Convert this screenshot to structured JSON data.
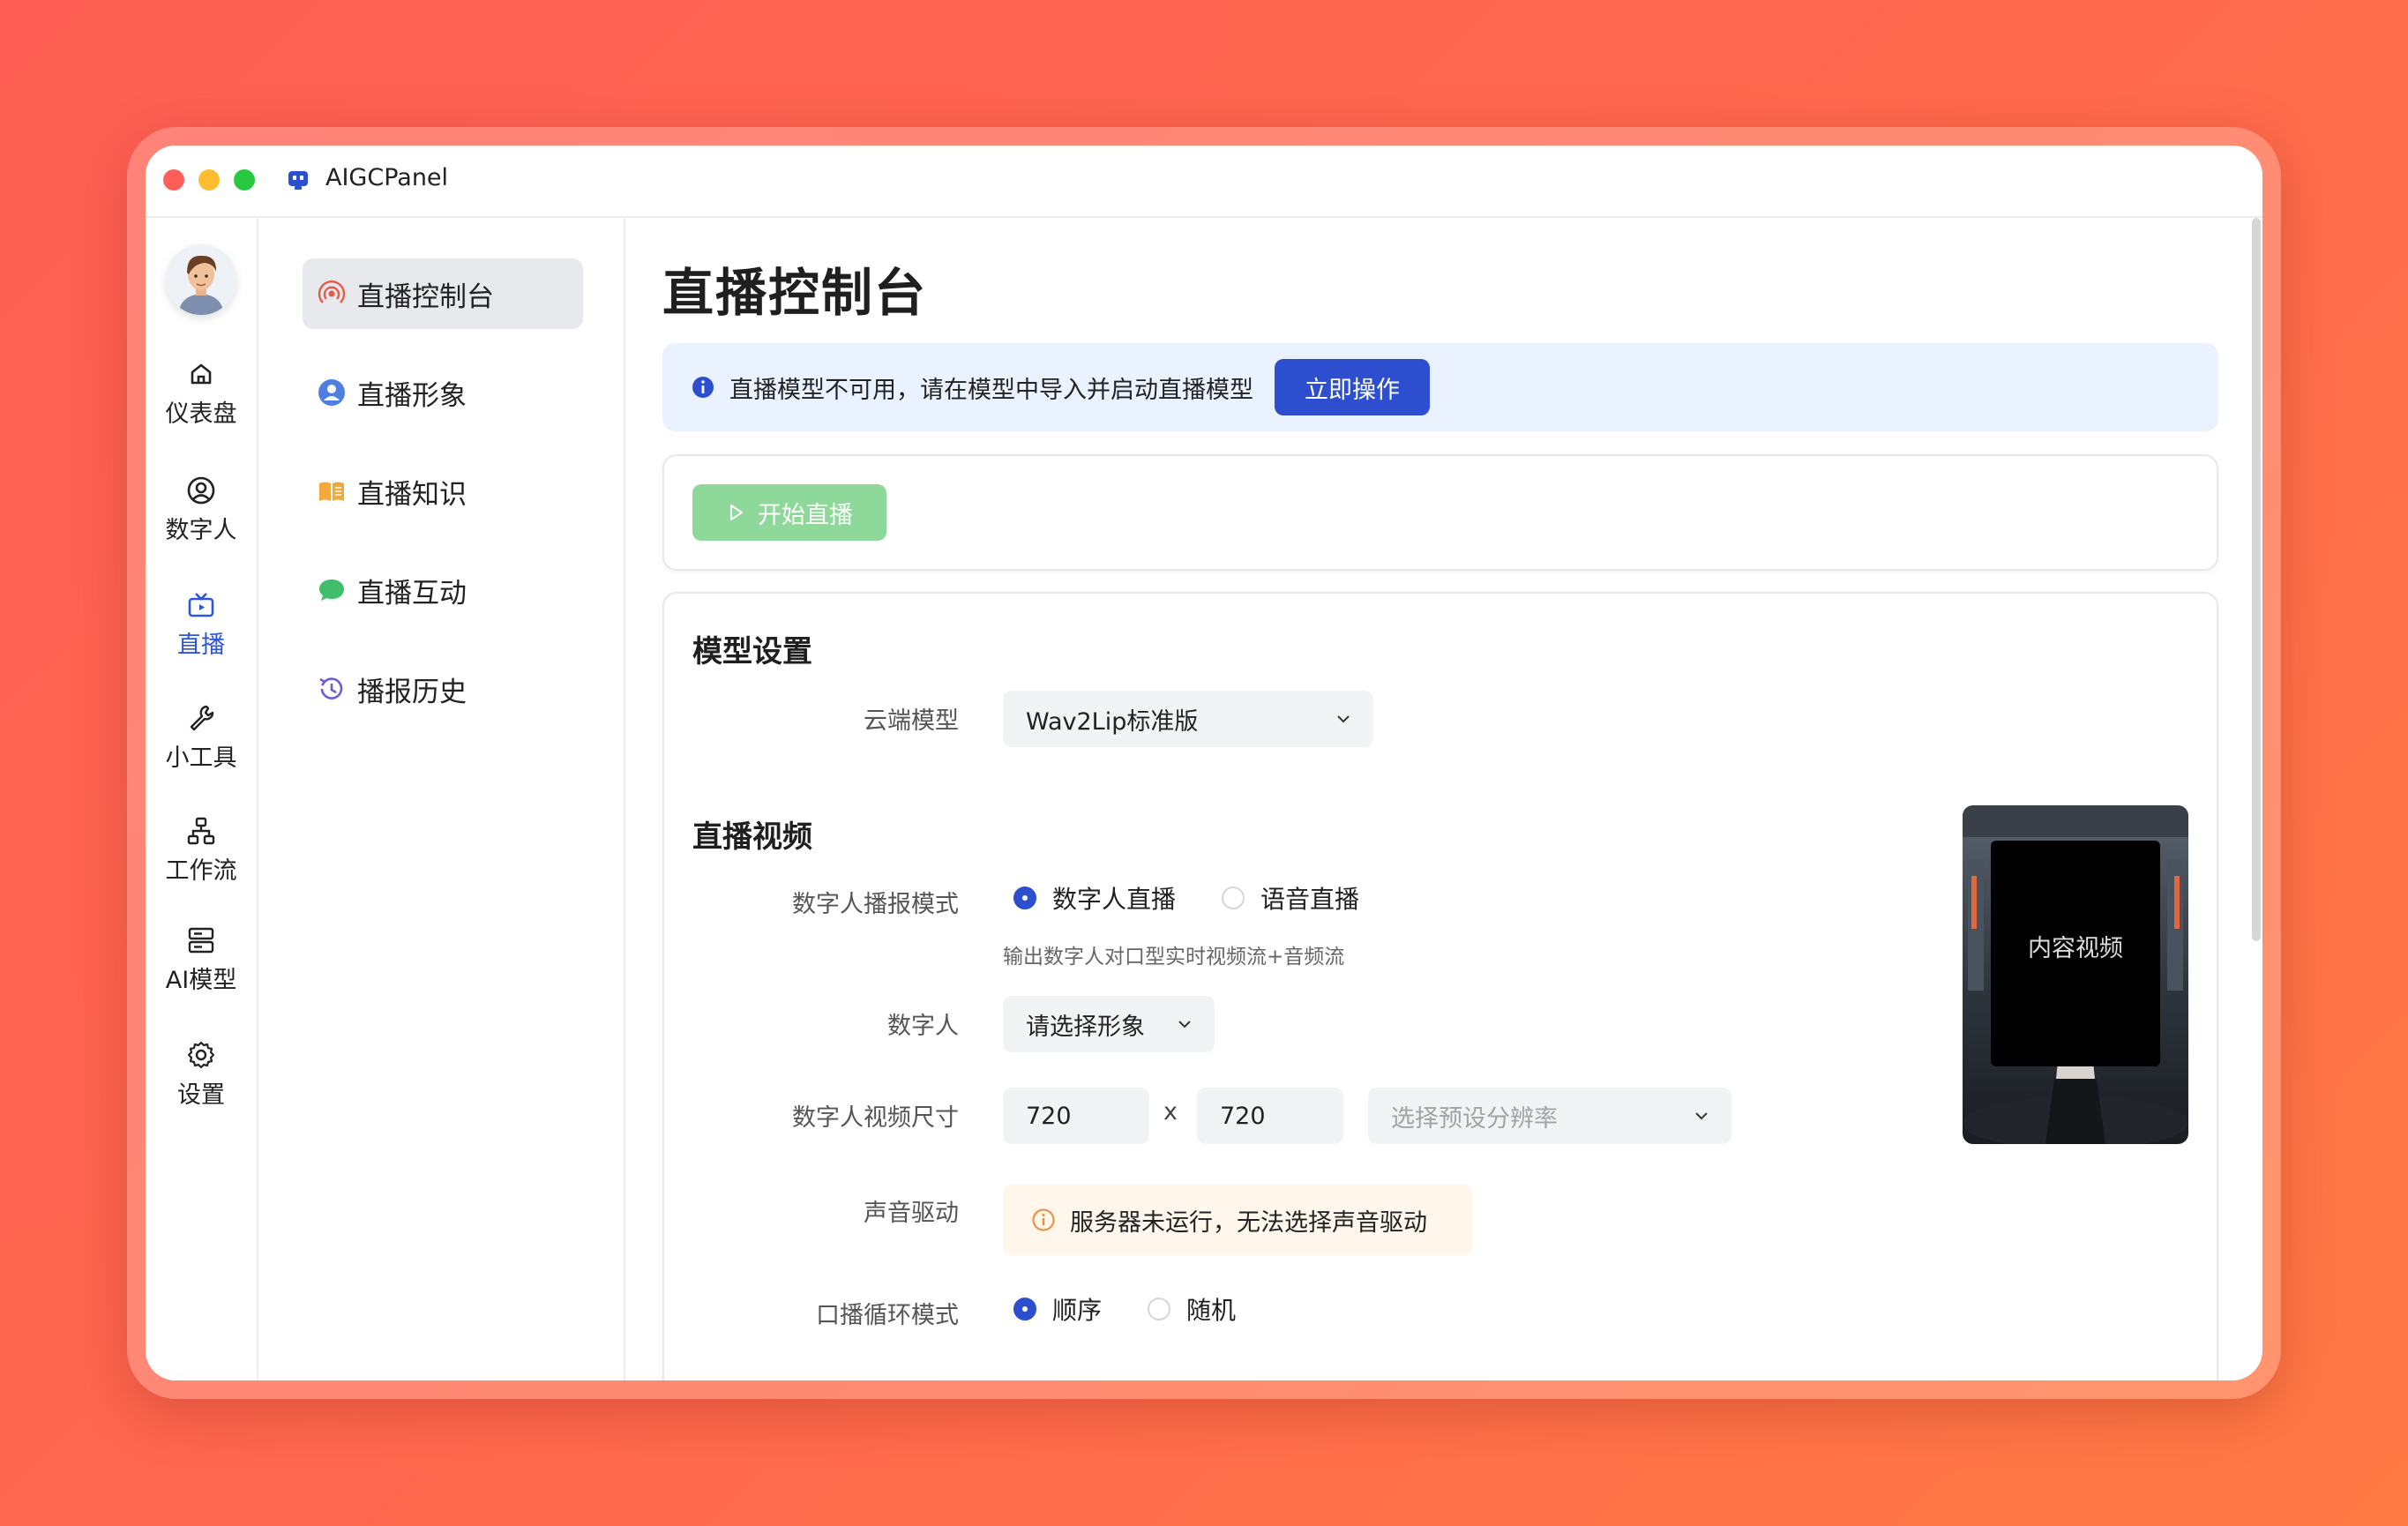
{
  "app": {
    "title": "AIGCPanel"
  },
  "nav": {
    "items": [
      {
        "label": "仪表盘",
        "icon": "home-icon"
      },
      {
        "label": "数字人",
        "icon": "user-circle-icon"
      },
      {
        "label": "直播",
        "icon": "tv-icon",
        "active": true
      },
      {
        "label": "小工具",
        "icon": "wrench-icon"
      },
      {
        "label": "工作流",
        "icon": "workflow-icon"
      },
      {
        "label": "AI模型",
        "icon": "server-icon"
      },
      {
        "label": "设置",
        "icon": "gear-icon"
      }
    ]
  },
  "subnav": {
    "items": [
      {
        "label": "直播控制台",
        "icon": "broadcast-icon",
        "active": true
      },
      {
        "label": "直播形象",
        "icon": "avatar-icon"
      },
      {
        "label": "直播知识",
        "icon": "book-icon"
      },
      {
        "label": "直播互动",
        "icon": "chat-icon"
      },
      {
        "label": "播报历史",
        "icon": "history-icon"
      }
    ]
  },
  "main": {
    "title": "直播控制台",
    "alert": {
      "text": "直播模型不可用，请在模型中导入并启动直播模型",
      "action": "立即操作"
    },
    "start_button": "开始直播",
    "model_section": {
      "title": "模型设置",
      "cloud_model_label": "云端模型",
      "cloud_model_value": "Wav2Lip标准版"
    },
    "video_section": {
      "title": "直播视频",
      "mode_label": "数字人播报模式",
      "mode_options": [
        "数字人直播",
        "语音直播"
      ],
      "mode_selected": "数字人直播",
      "mode_hint": "输出数字人对口型实时视频流+音频流",
      "avatar_label": "数字人",
      "avatar_placeholder": "请选择形象",
      "size_label": "数字人视频尺寸",
      "width": "720",
      "times": "x",
      "height": "720",
      "preset_placeholder": "选择预设分辨率",
      "voice_label": "声音驱动",
      "voice_warning": "服务器未运行，无法选择声音驱动",
      "loop_label": "口播循环模式",
      "loop_options": [
        "顺序",
        "随机"
      ],
      "loop_selected": "顺序",
      "preview_text": "内容视频"
    }
  },
  "colors": {
    "accent": "#2d4fcf",
    "start_disabled": "#8ed99a",
    "alert_bg": "#ebf2ff",
    "warn_bg": "#fff6ec"
  }
}
